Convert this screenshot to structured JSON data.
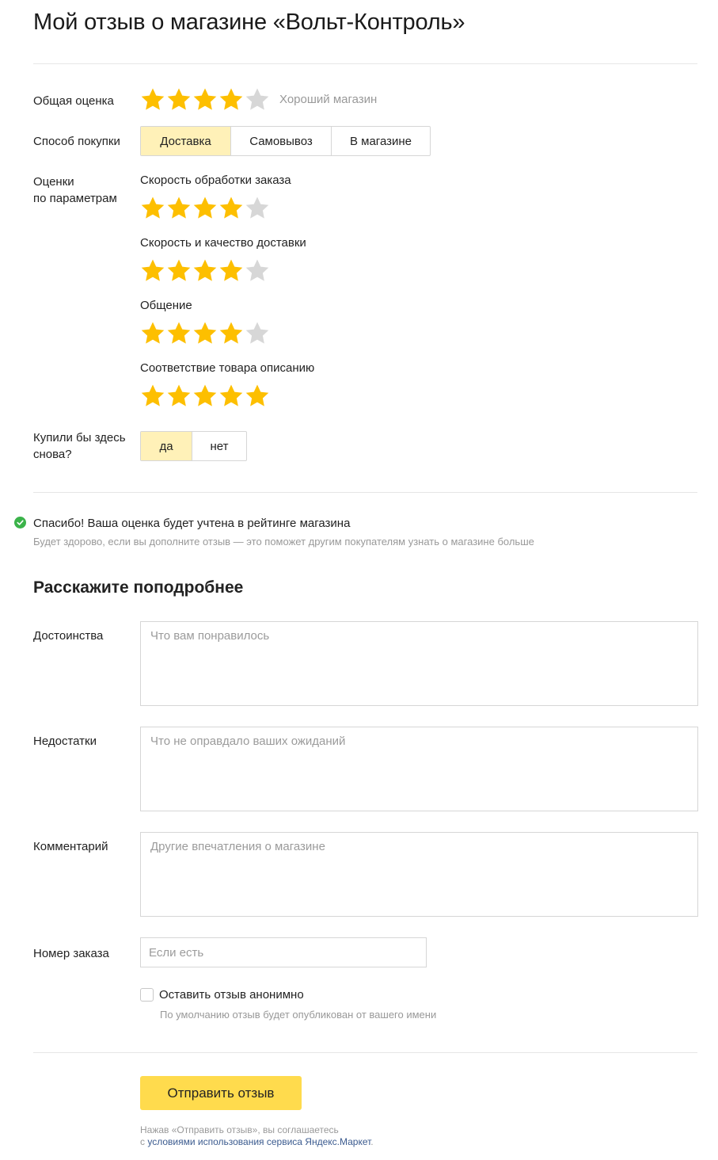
{
  "header": {
    "title": "Мой отзыв о магазине «Вольт-Контроль»"
  },
  "rating": {
    "label": "Общая оценка",
    "value": 4,
    "max": 5,
    "text": "Хороший магазин",
    "star_color": "#fdbf00",
    "empty_star_color": "#d7d7d7"
  },
  "purchase": {
    "label": "Способ покупки",
    "options": [
      "Доставка",
      "Самовывоз",
      "В магазине"
    ],
    "selected": "Доставка"
  },
  "params": {
    "label_line1": "Оценки",
    "label_line2": "по параметрам",
    "items": [
      {
        "label": "Скорость обработки заказа",
        "value": 4
      },
      {
        "label": "Скорость и качество доставки",
        "value": 4
      },
      {
        "label": "Общение",
        "value": 4
      },
      {
        "label": "Соответствие товара описанию",
        "value": 5
      }
    ]
  },
  "buy_again": {
    "label_line1": "Купили бы здесь",
    "label_line2": "снова?",
    "options": [
      "да",
      "нет"
    ],
    "selected": "да"
  },
  "notice": {
    "title": "Спасибо! Ваша оценка будет учтена в рейтинге магазина",
    "subtitle": "Будет здорово, если вы дополните отзыв — это поможет другим покупателям узнать о магазине больше"
  },
  "details": {
    "heading": "Расскажите поподробнее",
    "pros": {
      "label": "Достоинства",
      "placeholder": "Что вам понравилось",
      "value": ""
    },
    "cons": {
      "label": "Недостатки",
      "placeholder": "Что не оправдало ваших ожиданий",
      "value": ""
    },
    "comment": {
      "label": "Комментарий",
      "placeholder": "Другие впечатления о магазине",
      "value": ""
    },
    "order": {
      "label": "Номер заказа",
      "placeholder": "Если есть",
      "value": ""
    }
  },
  "anonymous": {
    "label": "Оставить отзыв анонимно",
    "hint": "По умолчанию отзыв будет опубликован от вашего имени",
    "checked": false
  },
  "submit": {
    "label": "Отправить отзыв",
    "color": "#ffdb4d"
  },
  "terms": {
    "line1": "Нажав «Отправить отзыв», вы соглашаетесь",
    "prefix": "с ",
    "link_text": "условиями использования сервиса Яндекс.Маркет",
    "suffix": "."
  }
}
